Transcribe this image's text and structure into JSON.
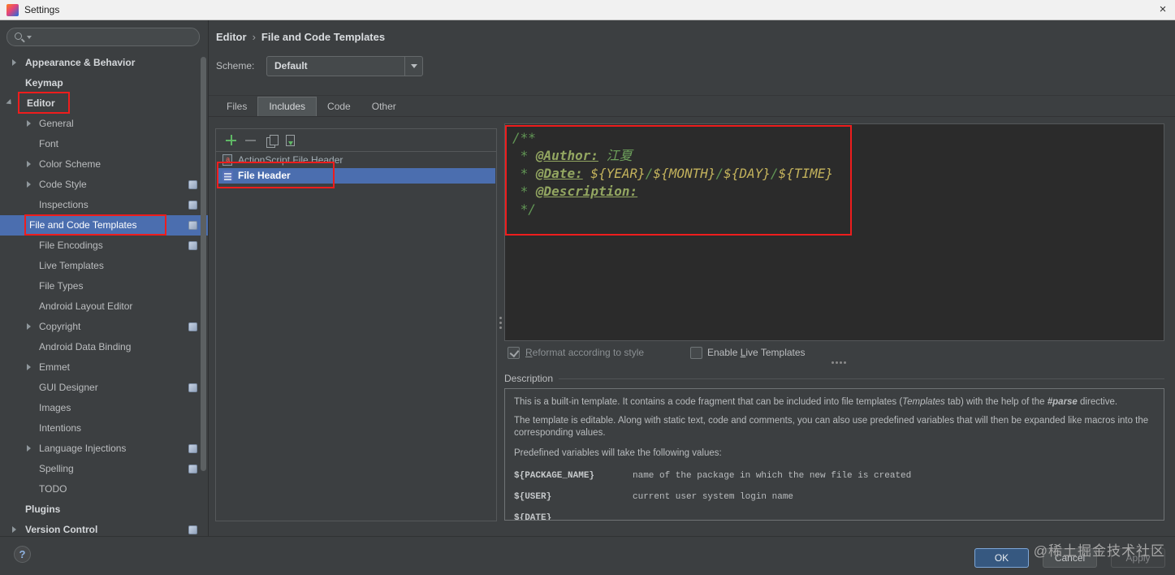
{
  "window": {
    "title": "Settings",
    "close_glyph": "×"
  },
  "sidebar": {
    "search": {
      "value": ""
    },
    "items": [
      {
        "label": "Appearance & Behavior"
      },
      {
        "label": "Keymap"
      },
      {
        "label": "Editor"
      },
      {
        "label": "General"
      },
      {
        "label": "Font"
      },
      {
        "label": "Color Scheme"
      },
      {
        "label": "Code Style"
      },
      {
        "label": "Inspections"
      },
      {
        "label": "File and Code Templates"
      },
      {
        "label": "File Encodings"
      },
      {
        "label": "Live Templates"
      },
      {
        "label": "File Types"
      },
      {
        "label": "Android Layout Editor"
      },
      {
        "label": "Copyright"
      },
      {
        "label": "Android Data Binding"
      },
      {
        "label": "Emmet"
      },
      {
        "label": "GUI Designer"
      },
      {
        "label": "Images"
      },
      {
        "label": "Intentions"
      },
      {
        "label": "Language Injections"
      },
      {
        "label": "Spelling"
      },
      {
        "label": "TODO"
      },
      {
        "label": "Plugins"
      },
      {
        "label": "Version Control"
      }
    ]
  },
  "breadcrumb": {
    "section": "Editor",
    "separator": "›",
    "page": "File and Code Templates"
  },
  "scheme": {
    "label": "Scheme:",
    "value": "Default"
  },
  "tabs": {
    "selected": "Includes",
    "items": [
      {
        "label": "Files"
      },
      {
        "label": "Includes"
      },
      {
        "label": "Code"
      },
      {
        "label": "Other"
      }
    ]
  },
  "templates": {
    "selected": "File Header",
    "items": [
      {
        "label": "ActionScript File Header"
      },
      {
        "label": "File Header"
      }
    ]
  },
  "editor": {
    "lines": [
      {
        "s": [
          {
            "t": "/**"
          }
        ]
      },
      {
        "s": [
          {
            "t": " * "
          },
          {
            "t": "@Author:"
          },
          {
            "t": " "
          },
          {
            "t": "江夏"
          }
        ]
      },
      {
        "s": [
          {
            "t": " * "
          },
          {
            "t": "@Date:"
          },
          {
            "t": " "
          },
          {
            "t": "${YEAR}"
          },
          {
            "t": "/"
          },
          {
            "t": "${MONTH}"
          },
          {
            "t": "/"
          },
          {
            "t": "${DAY}"
          },
          {
            "t": "/"
          },
          {
            "t": "${TIME}"
          }
        ]
      },
      {
        "s": [
          {
            "t": " * "
          },
          {
            "t": "@Description:"
          }
        ]
      },
      {
        "s": [
          {
            "t": " */"
          }
        ]
      }
    ]
  },
  "options": {
    "reformat": {
      "pre": "",
      "mnemonic": "R",
      "rest": "eformat according to style",
      "checked": true
    },
    "live_templates": {
      "pre": "Enable ",
      "mnemonic": "L",
      "rest": "ive Templates",
      "checked": false
    }
  },
  "description": {
    "heading": "Description",
    "p1": {
      "a": "This is a built-in template. It contains a code fragment that can be included into file templates (",
      "b": "Templates",
      "c": " tab) with the help of the ",
      "d": "#parse",
      "e": " directive."
    },
    "p2": "The template is editable. Along with static text, code and comments, you can also use predefined variables that will then be expanded like macros into the corresponding values.",
    "p3": "Predefined variables will take the following values:",
    "variables": [
      {
        "name": "${PACKAGE_NAME}",
        "meaning": "name of the package in which the new file is created"
      },
      {
        "name": "${USER}",
        "meaning": "current user system login name"
      },
      {
        "name": "${DATE}",
        "meaning": ""
      }
    ]
  },
  "footer": {
    "help_glyph": "?",
    "ok_label": "OK",
    "cancel_label": "Cancel",
    "apply_label": "Apply",
    "watermark": "@稀土掘金技术社区"
  },
  "colors": {
    "selection_blue": "#4b6eaf",
    "editor_background": "#2b2b2b",
    "panel_background": "#3c3f41",
    "annotation_red": "#ee1d1d",
    "ok_button_blue": "#365880"
  }
}
